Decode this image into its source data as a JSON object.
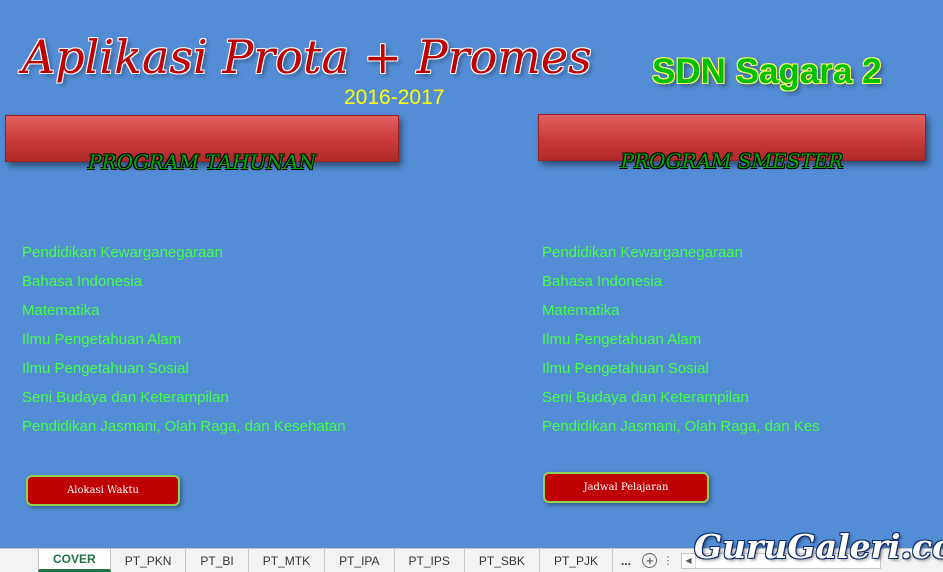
{
  "header": {
    "app_title": "Aplikasi Prota + Promes",
    "year": "2016-2017",
    "school": "SDN Sagara 2"
  },
  "program_tahunan": {
    "title": "PROGRAM  TAHUNAN",
    "subjects": [
      "Pendidikan Kewarganegaraan",
      "Bahasa Indonesia",
      "Matematika",
      "Ilmu Pengetahuan Alam",
      "Ilmu Pengetahuan Sosial",
      "Seni Budaya dan Keterampilan",
      "Pendidikan Jasmani, Olah Raga, dan Kesehatan"
    ],
    "button_label": "Alokasi Waktu"
  },
  "program_semester": {
    "title": "PROGRAM SMESTER",
    "subjects": [
      "Pendidikan Kewarganegaraan",
      "Bahasa Indonesia",
      "Matematika",
      "Ilmu Pengetahuan Alam",
      "Ilmu Pengetahuan Sosial",
      "Seni Budaya dan Keterampilan",
      "Pendidikan Jasmani, Olah Raga, dan Kesehatan"
    ],
    "button_label": "Jadwal Pelajaran"
  },
  "tabs": {
    "items": [
      "COVER",
      "PT_PKN",
      "PT_BI",
      "PT_MTK",
      "PT_IPA",
      "PT_IPS",
      "PT_SBK",
      "PT_PJK"
    ],
    "active": "COVER",
    "more": "...",
    "add_icon": "plus-circle-icon"
  },
  "watermark": "GuruGaleri.com",
  "colors": {
    "background": "#538dd5",
    "title_red": "#c00000",
    "link_green": "#44ff44",
    "school_green": "#00c000",
    "year_yellow": "#ffff00",
    "excel_green": "#217346"
  }
}
